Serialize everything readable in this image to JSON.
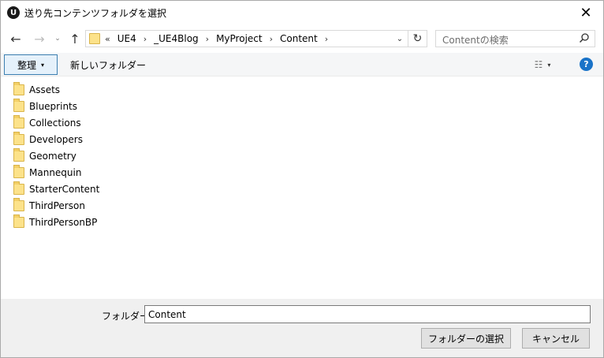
{
  "window": {
    "title": "送り先コンテンツフォルダを選択",
    "app_icon": "unreal-logo-icon",
    "app_icon_glyph": "U",
    "close_glyph": "✕"
  },
  "nav": {
    "back_glyph": "←",
    "forward_glyph": "→",
    "recent_glyph": "⌄",
    "up_glyph": "↑",
    "breadcrumb_more": "«",
    "breadcrumbs": [
      "UE4",
      "_UE4Blog",
      "MyProject",
      "Content"
    ],
    "separator": "›",
    "dropdown_glyph": "⌄",
    "refresh_glyph": "↻"
  },
  "search": {
    "placeholder": "Contentの検索",
    "icon": "search-icon"
  },
  "command_bar": {
    "organize_label": "整理",
    "caret_glyph": "▾",
    "new_folder_label": "新しいフォルダー",
    "view_icon": "view-options-icon",
    "view_glyph": "☷",
    "help_glyph": "?"
  },
  "folders": [
    {
      "name": "Assets"
    },
    {
      "name": "Blueprints"
    },
    {
      "name": "Collections"
    },
    {
      "name": "Developers"
    },
    {
      "name": "Geometry"
    },
    {
      "name": "Mannequin"
    },
    {
      "name": "StarterContent"
    },
    {
      "name": "ThirdPerson"
    },
    {
      "name": "ThirdPersonBP"
    }
  ],
  "footer": {
    "folder_label": "フォルダー:",
    "folder_value": "Content",
    "select_button": "フォルダーの選択",
    "cancel_button": "キャンセル"
  },
  "colors": {
    "accent": "#1a73c8",
    "folder_yellow": "#fce28a",
    "selected_button_border": "#3c7fb1"
  }
}
